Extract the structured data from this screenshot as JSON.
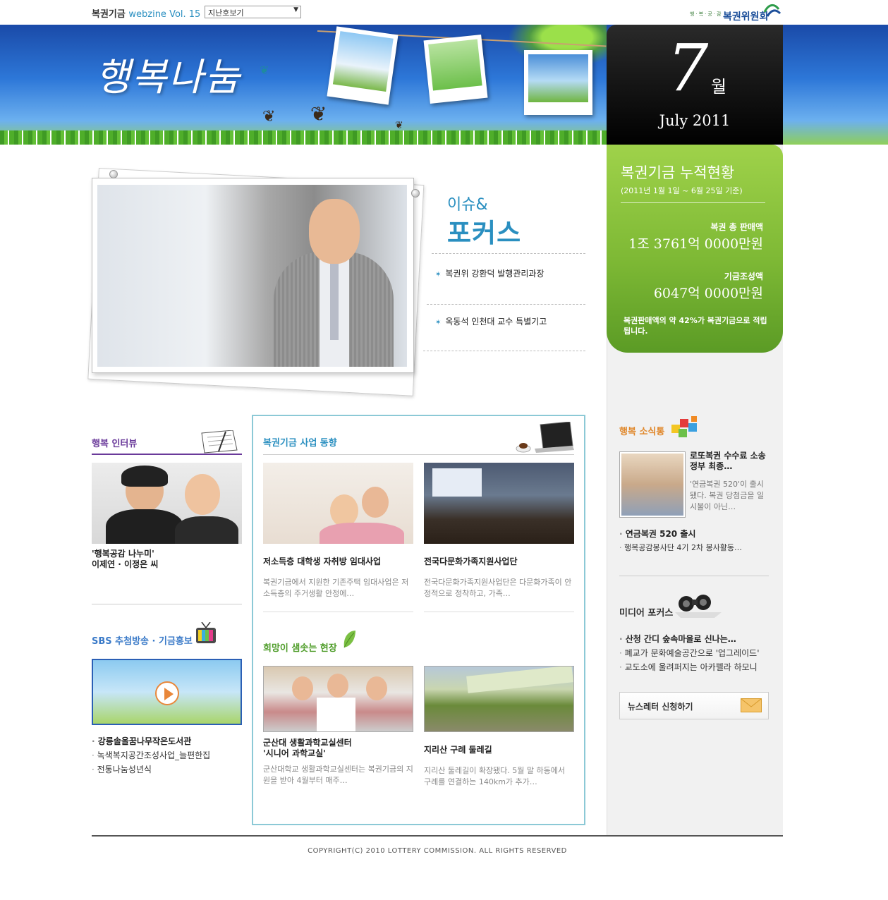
{
  "header": {
    "brand": "복권기금",
    "webzine": "webzine Vol. 15",
    "back_issue_select": "지난호보기",
    "logo_sub": "행·복·공·감",
    "logo_main": "복권위원회"
  },
  "banner": {
    "title": "행복나눔",
    "month_num": "7",
    "month_kr": "월",
    "date_en": "July  2011"
  },
  "fund": {
    "title": "복권기금 누적현황",
    "period": "(2011년 1월 1일 ~ 6월 25일 기준)",
    "sales_label": "복권 총 판매액",
    "sales_value": "1조 3761억 0000만원",
    "fund_label": "기금조성액",
    "fund_value": "6047억 0000만원",
    "note": "복권판매액의 약 42%가 복권기금으로 적립됩니다."
  },
  "focus": {
    "issue": "이슈&",
    "focus": "포커스",
    "links": [
      "복권위 강환덕 발행관리과장",
      "옥동석 인천대 교수 특별기고"
    ]
  },
  "interview": {
    "title": "행복 인터뷰",
    "caption_line1": "'행복공감 나누미'",
    "caption_line2": "이제연 · 이정은 씨"
  },
  "sbs": {
    "title": "SBS 추첨방송 · 기금홍보",
    "items": [
      "강릉솔올꿈나무작은도서관",
      "녹색복지공간조성사업_늘편한집",
      "전통나눔성년식"
    ]
  },
  "business": {
    "title": "복권기금 사업 동향",
    "items": [
      {
        "title": "저소득층 대학생 자취방 임대사업",
        "desc": "복권기금에서 지원한 기존주택 임대사업은 저소득층의 주거생활 안정에…"
      },
      {
        "title": "전국다문화가족지원사업단",
        "desc": "전국다문화가족지원사업단은 다문화가족이 안정적으로 정착하고, 가족…"
      }
    ]
  },
  "hope": {
    "title": "희망이 샘솟는 현장",
    "items": [
      {
        "title_line1": "군산대 생활과학교실센터",
        "title_line2": "'시니어 과학교실'",
        "desc": "군산대학교 생활과학교실센터는 복권기금의 지원을 받아 4월부터 매주…"
      },
      {
        "title_line1": "지리산 구례 둘레길",
        "title_line2": "",
        "desc": "지리산 둘레길이 확장됐다. 5월 말 하동에서 구례를 연결하는 140km가 추가…"
      }
    ]
  },
  "news": {
    "title": "행복 소식통",
    "headline": "로또복권 수수료 소송 정부 최종…",
    "desc": "'연금복권 520'이 출시됐다. 복권 당첨금을 일시불이 아닌…",
    "items": [
      "연금복권 520 출시",
      "행복공감봉사단 4기 2차 봉사활동…"
    ]
  },
  "media": {
    "title": "미디어 포커스",
    "items": [
      "산청 간디 숲속마을로 신나는…",
      "폐교가 문화예술공간으로 '업그레이드'",
      "교도소에 울려퍼지는 아카펠라 하모니"
    ]
  },
  "newsletter": {
    "label": "뉴스레터 신청하기"
  },
  "footer": {
    "copyright": "COPYRIGHT(C) 2010 LOTTERY COMMISSION. ALL RIGHTS RESERVED"
  },
  "colors": {
    "accent_blue": "#2a8fc0",
    "accent_green": "#7eb935",
    "accent_purple": "#6a3a9a",
    "accent_orange": "#e0872a"
  }
}
